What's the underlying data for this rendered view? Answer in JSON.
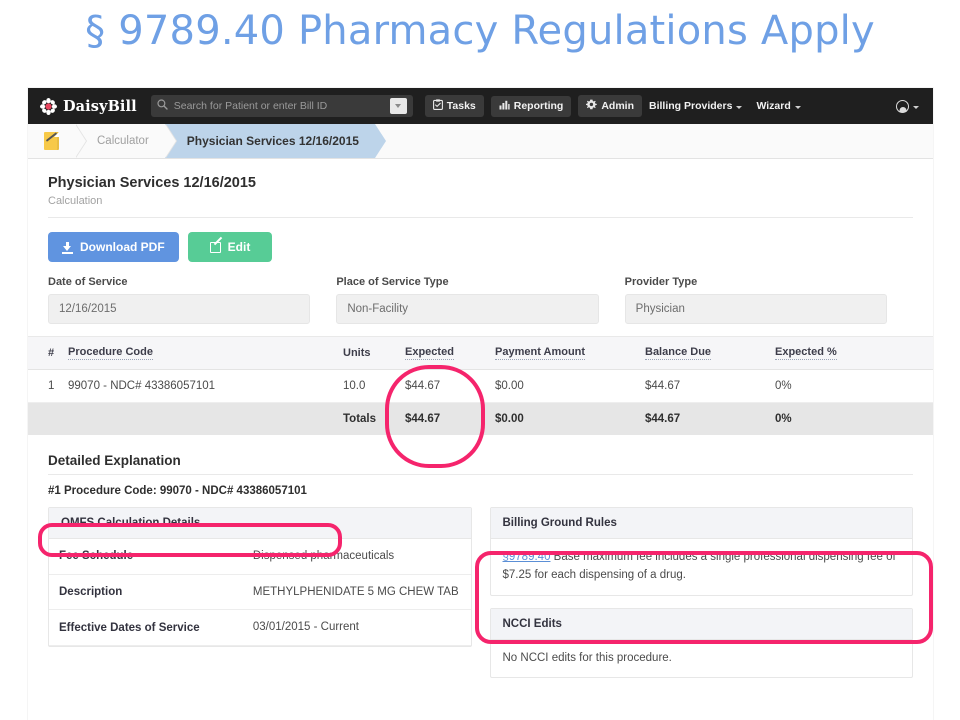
{
  "slide": {
    "title": "§ 9789.40 Pharmacy Regulations Apply",
    "title_color": "#6fa0e5"
  },
  "navbar": {
    "brand": "DaisyBill",
    "search_placeholder": "Search for Patient or enter Bill ID",
    "tasks_label": "Tasks",
    "reporting_label": "Reporting",
    "admin_label": "Admin",
    "billing_providers_label": "Billing Providers",
    "wizard_label": "Wizard"
  },
  "breadcrumb": {
    "calculator": "Calculator",
    "current": "Physician Services 12/16/2015"
  },
  "page": {
    "title": "Physician Services 12/16/2015",
    "subtitle": "Calculation"
  },
  "actions": {
    "download_pdf": "Download PDF",
    "edit": "Edit"
  },
  "fields": [
    {
      "label": "Date of Service",
      "value": "12/16/2015"
    },
    {
      "label": "Place of Service Type",
      "value": "Non-Facility"
    },
    {
      "label": "Provider Type",
      "value": "Physician"
    }
  ],
  "procedures_table": {
    "headers": [
      "#",
      "Procedure Code",
      "Units",
      "Expected",
      "Payment Amount",
      "Balance Due",
      "Expected %"
    ],
    "rows": [
      {
        "num": "1",
        "code": "99070 - NDC# 43386057101",
        "units": "10.0",
        "expected": "$44.67",
        "payment": "$0.00",
        "balance": "$44.67",
        "expected_pct": "0%"
      }
    ],
    "totals": {
      "label": "Totals",
      "expected": "$44.67",
      "payment": "$0.00",
      "balance": "$44.67",
      "expected_pct": "0%"
    }
  },
  "detail": {
    "heading": "Detailed Explanation",
    "procedure_line": "#1 Procedure Code: 99070 - NDC# 43386057101"
  },
  "omfs": {
    "title": "OMFS Calculation Details",
    "rows": [
      {
        "key": "Fee Schedule",
        "value": "Dispensed pharmaceuticals"
      },
      {
        "key": "Description",
        "value": "METHYLPHENIDATE 5 MG CHEW TAB"
      },
      {
        "key": "Effective Dates of Service",
        "value": "03/01/2015 - Current"
      }
    ]
  },
  "ground_rules": {
    "title": "Billing Ground Rules",
    "link": "§9789.40",
    "text": " Base maximum fee includes a single professional dispensing fee of $7.25 for each dispensing of a drug."
  },
  "ncci": {
    "title": "NCCI Edits",
    "text": "No NCCI edits for this procedure."
  },
  "annotations": {
    "color": "#f5246c"
  }
}
